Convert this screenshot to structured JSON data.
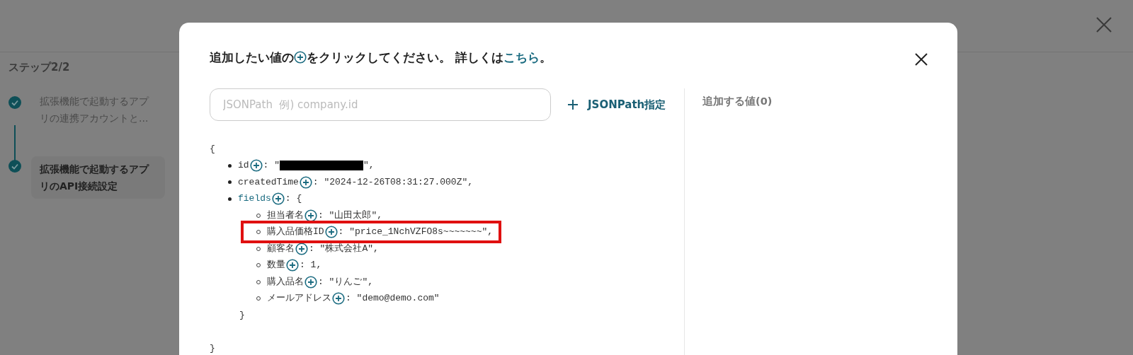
{
  "page": {
    "steps_title": "ステップ2/2",
    "steps": [
      {
        "label": "拡張機能で起動するアプリの連携アカウントと...",
        "done": true,
        "selected": false
      },
      {
        "label": "拡張機能で起動するアプリのAPI接続設定",
        "done": true,
        "selected": true
      }
    ]
  },
  "modal": {
    "instruction": {
      "before": "追加したい値の",
      "after": "をクリックしてください。 詳しくは",
      "link": "こちら",
      "end": "。"
    },
    "search": {
      "placeholder": "JSONPath  例) company.id"
    },
    "add_path_button": "JSONPath指定",
    "added_title": "追加する値(0)",
    "json_view": {
      "open": "{",
      "close": "}",
      "items": [
        {
          "key": "id",
          "kind": "value",
          "redacted": true,
          "before": ": \"",
          "after": "\",",
          "highlighted": false
        },
        {
          "key": "createdTime",
          "kind": "value",
          "before": ": \"2024-12-26T08:31:27.000Z\",",
          "highlighted": false
        },
        {
          "key": "fields",
          "kind": "object",
          "before": ": {",
          "close": "}",
          "highlighted": false,
          "children": [
            {
              "key": "担当者名",
              "kind": "value",
              "before": ": \"山田太郎\",",
              "highlighted": false
            },
            {
              "key": "購入品価格ID",
              "kind": "value",
              "before": ": \"price_1NchVZFO8s~~~~~~~\",",
              "highlighted": true
            },
            {
              "key": "顧客名",
              "kind": "value",
              "before": ": \"株式会社A\",",
              "highlighted": false
            },
            {
              "key": "数量",
              "kind": "value",
              "before": ": 1,",
              "highlighted": false
            },
            {
              "key": "購入品名",
              "kind": "value",
              "before": ": \"りんご\",",
              "highlighted": false
            },
            {
              "key": "メールアドレス",
              "kind": "value",
              "before": ": \"demo@demo.com\"",
              "highlighted": false
            }
          ]
        }
      ]
    }
  }
}
